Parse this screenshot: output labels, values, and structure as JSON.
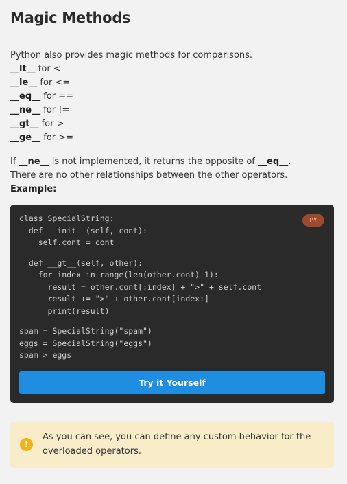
{
  "title": "Magic Methods",
  "intro": "Python also provides magic methods for comparisons.",
  "methods": [
    {
      "name": "__lt__",
      "desc": " for <"
    },
    {
      "name": "__le__",
      "desc": " for <="
    },
    {
      "name": "__eq__",
      "desc": " for =="
    },
    {
      "name": "__ne__",
      "desc": " for !="
    },
    {
      "name": "__gt__",
      "desc": " for >"
    },
    {
      "name": "__ge__",
      "desc": " for >="
    }
  ],
  "note_para": {
    "part1": "If ",
    "ne": "__ne__",
    "part2": " is not implemented, it returns the opposite of ",
    "eq": "__eq__",
    "part3": ".",
    "line2": "There are no other relationships between the other operators.",
    "example_label": "Example:"
  },
  "code": {
    "language": "PY",
    "block1": "class SpecialString:\n  def __init__(self, cont):\n    self.cont = cont",
    "block2": "  def __gt__(self, other):\n    for index in range(len(other.cont)+1):\n      result = other.cont[:index] + \">\" + self.cont\n      result += \">\" + other.cont[index:]\n      print(result)",
    "block3": "spam = SpecialString(\"spam\")\neggs = SpecialString(\"eggs\")\nspam > eggs",
    "button_label": "Try it Yourself"
  },
  "callout": {
    "icon": "!",
    "text": "As you can see, you can define any custom behavior for the overloaded operators.",
    "colors": {
      "background": "#f8ecc9",
      "icon": "#f1b21c"
    }
  },
  "colors": {
    "accent": "#1f8de0",
    "code_bg": "#2a2a2a",
    "badge": "#9b4a2e"
  }
}
